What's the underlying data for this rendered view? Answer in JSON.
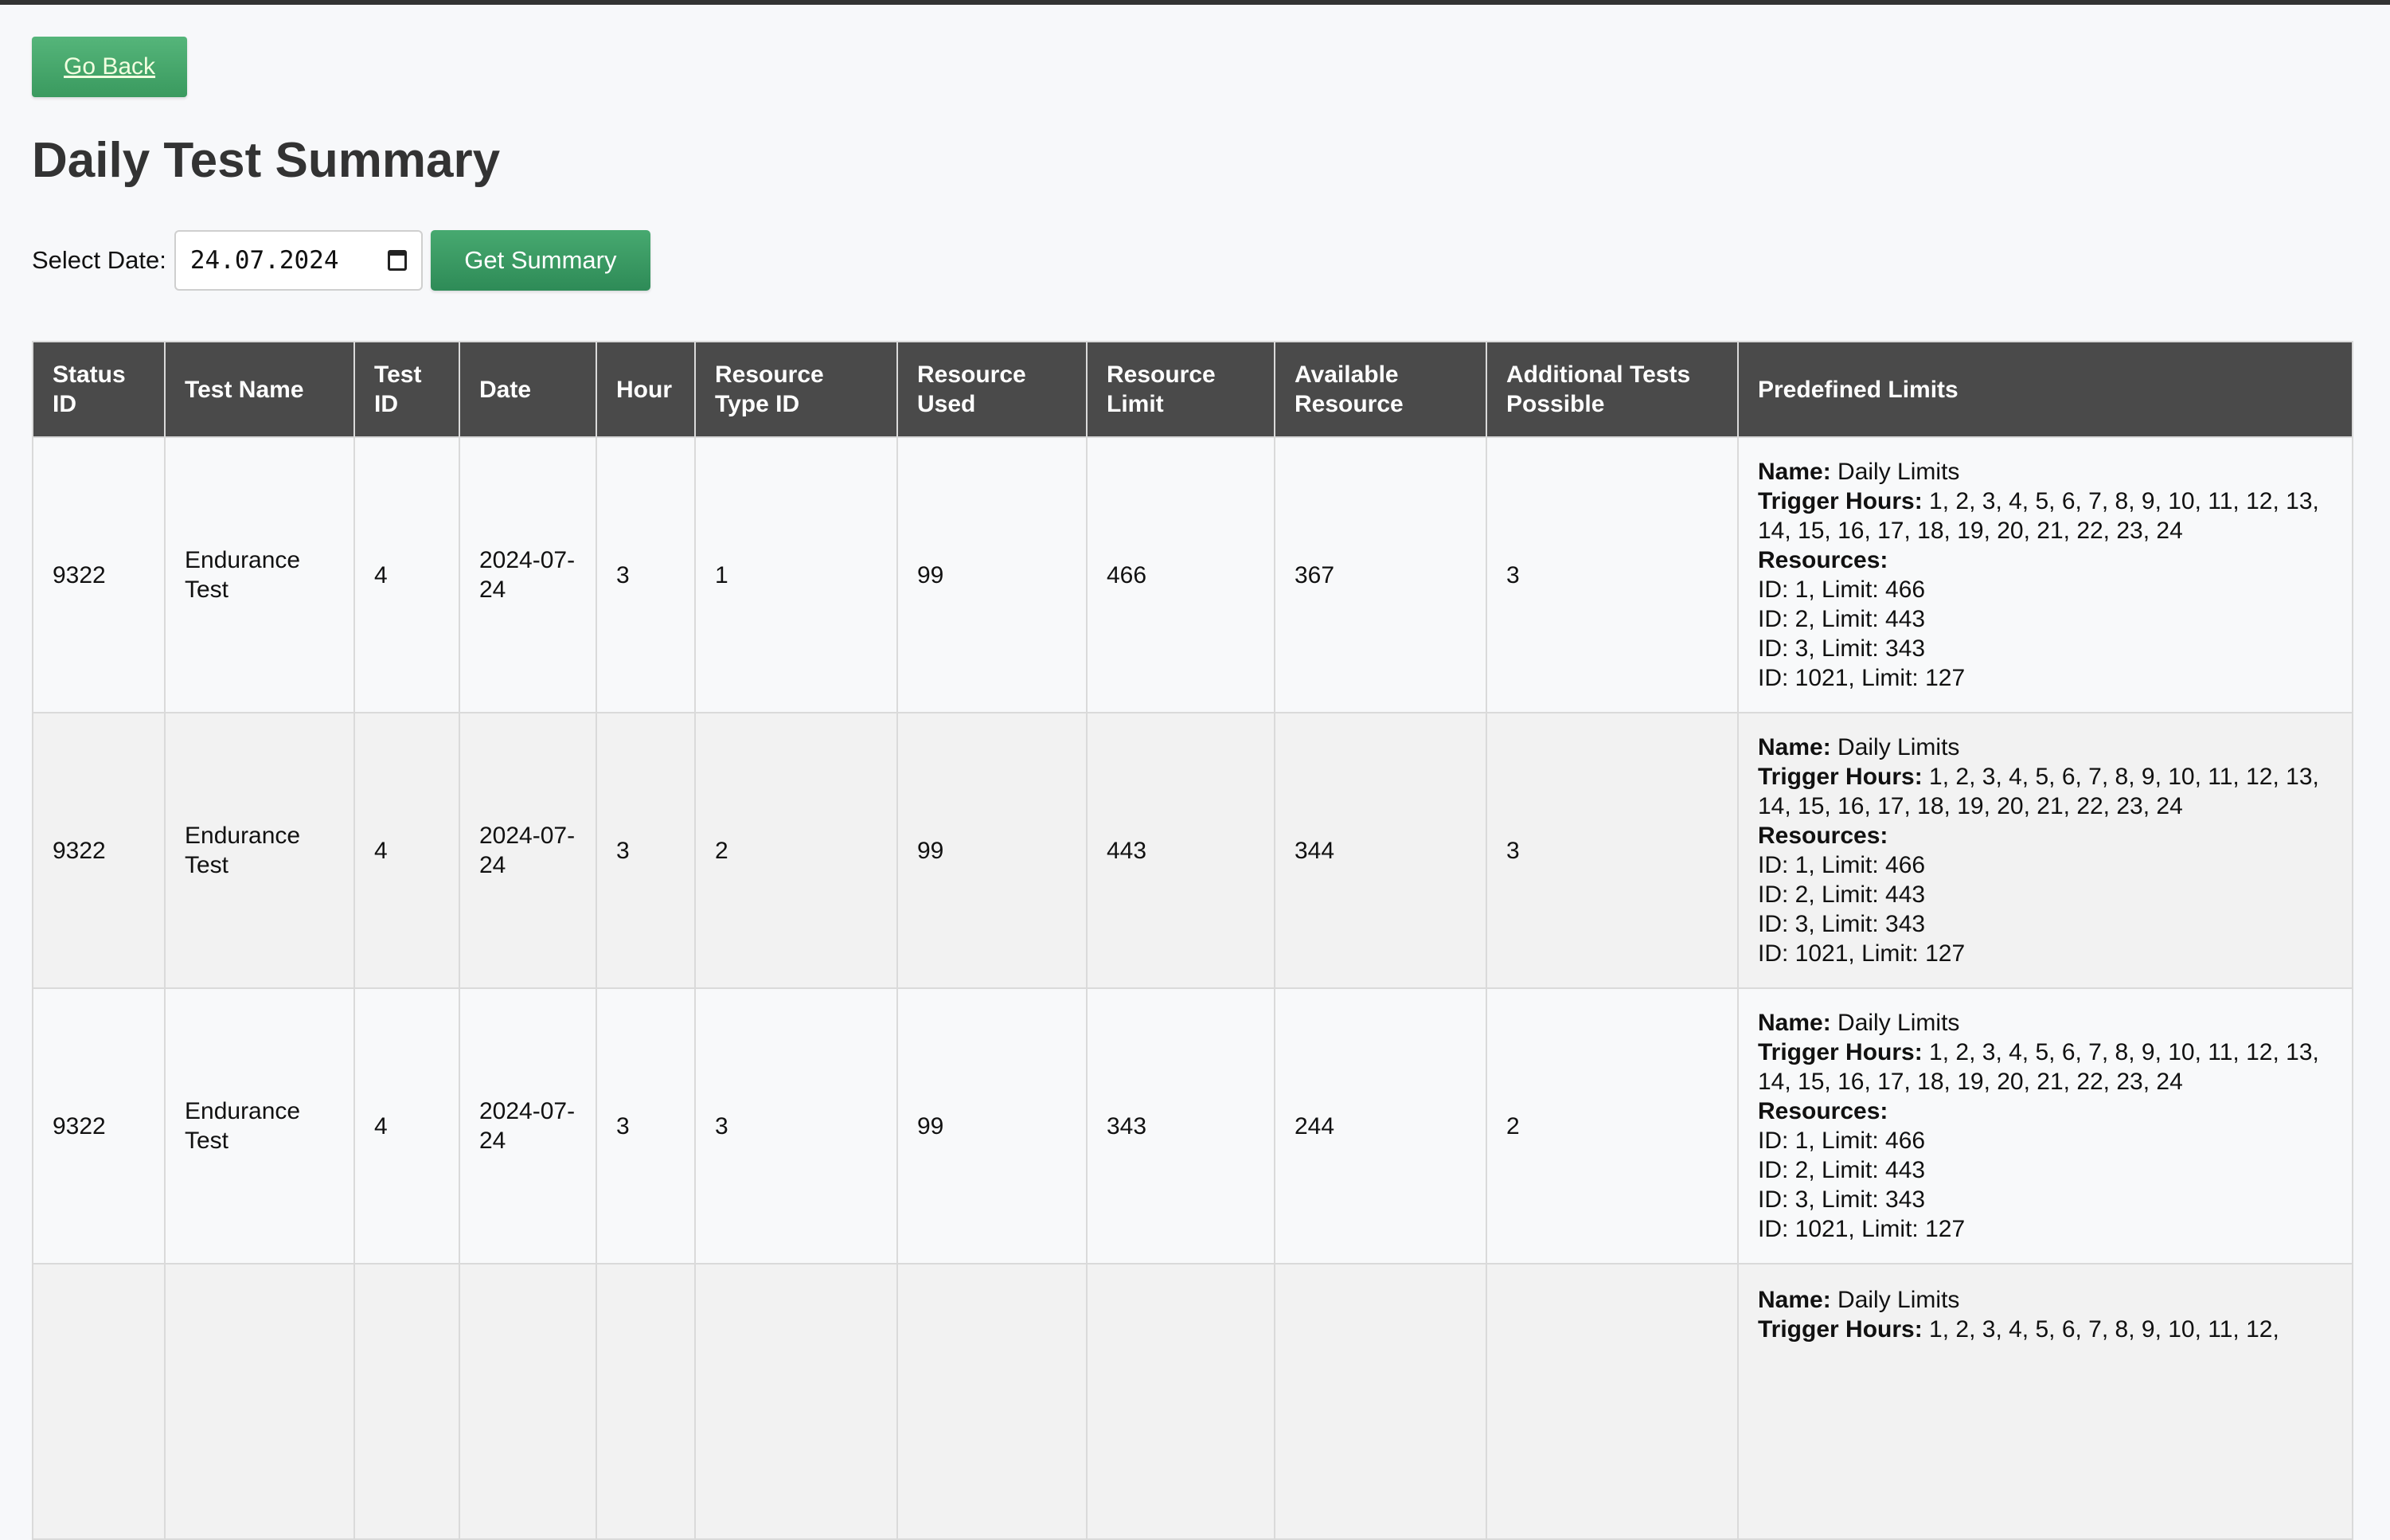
{
  "nav": {
    "back_label": "Go Back"
  },
  "page": {
    "title": "Daily Test Summary"
  },
  "filter": {
    "label": "Select Date:",
    "date_value": "24.07.2024",
    "submit_label": "Get Summary"
  },
  "table": {
    "headers": {
      "status_id": "Status ID",
      "test_name": "Test Name",
      "test_id": "Test ID",
      "date": "Date",
      "hour": "Hour",
      "resource_type_id": "Resource Type ID",
      "resource_used": "Resource Used",
      "resource_limit": "Resource Limit",
      "available_resource": "Available Resource",
      "additional_tests": "Additional Tests Possible",
      "predefined_limits": "Predefined Limits"
    },
    "rows": [
      {
        "status_id": "9322",
        "test_name": "Endurance Test",
        "test_id": "4",
        "date": "2024-07-24",
        "hour": "3",
        "resource_type_id": "1",
        "resource_used": "99",
        "resource_limit": "466",
        "available_resource": "367",
        "additional_tests": "3",
        "limits": {
          "name_label": "Name:",
          "name": "Daily Limits",
          "trigger_label": "Trigger Hours:",
          "trigger_hours": "1, 2, 3, 4, 5, 6, 7, 8, 9, 10, 11, 12, 13, 14, 15, 16, 17, 18, 19, 20, 21, 22, 23, 24",
          "resources_label": "Resources:",
          "resources": [
            "ID: 1, Limit: 466",
            "ID: 2, Limit: 443",
            "ID: 3, Limit: 343",
            "ID: 1021, Limit: 127"
          ]
        }
      },
      {
        "status_id": "9322",
        "test_name": "Endurance Test",
        "test_id": "4",
        "date": "2024-07-24",
        "hour": "3",
        "resource_type_id": "2",
        "resource_used": "99",
        "resource_limit": "443",
        "available_resource": "344",
        "additional_tests": "3",
        "limits": {
          "name_label": "Name:",
          "name": "Daily Limits",
          "trigger_label": "Trigger Hours:",
          "trigger_hours": "1, 2, 3, 4, 5, 6, 7, 8, 9, 10, 11, 12, 13, 14, 15, 16, 17, 18, 19, 20, 21, 22, 23, 24",
          "resources_label": "Resources:",
          "resources": [
            "ID: 1, Limit: 466",
            "ID: 2, Limit: 443",
            "ID: 3, Limit: 343",
            "ID: 1021, Limit: 127"
          ]
        }
      },
      {
        "status_id": "9322",
        "test_name": "Endurance Test",
        "test_id": "4",
        "date": "2024-07-24",
        "hour": "3",
        "resource_type_id": "3",
        "resource_used": "99",
        "resource_limit": "343",
        "available_resource": "244",
        "additional_tests": "2",
        "limits": {
          "name_label": "Name:",
          "name": "Daily Limits",
          "trigger_label": "Trigger Hours:",
          "trigger_hours": "1, 2, 3, 4, 5, 6, 7, 8, 9, 10, 11, 12, 13, 14, 15, 16, 17, 18, 19, 20, 21, 22, 23, 24",
          "resources_label": "Resources:",
          "resources": [
            "ID: 1, Limit: 466",
            "ID: 2, Limit: 443",
            "ID: 3, Limit: 343",
            "ID: 1021, Limit: 127"
          ]
        }
      },
      {
        "status_id": "",
        "test_name": "",
        "test_id": "",
        "date": "",
        "hour": "",
        "resource_type_id": "",
        "resource_used": "",
        "resource_limit": "",
        "available_resource": "",
        "additional_tests": "",
        "limits": {
          "name_label": "Name:",
          "name": "Daily Limits",
          "trigger_label": "Trigger Hours:",
          "trigger_hours": "1, 2, 3, 4, 5, 6, 7, 8, 9, 10, 11, 12,",
          "resources_label": "",
          "resources": []
        }
      }
    ]
  }
}
